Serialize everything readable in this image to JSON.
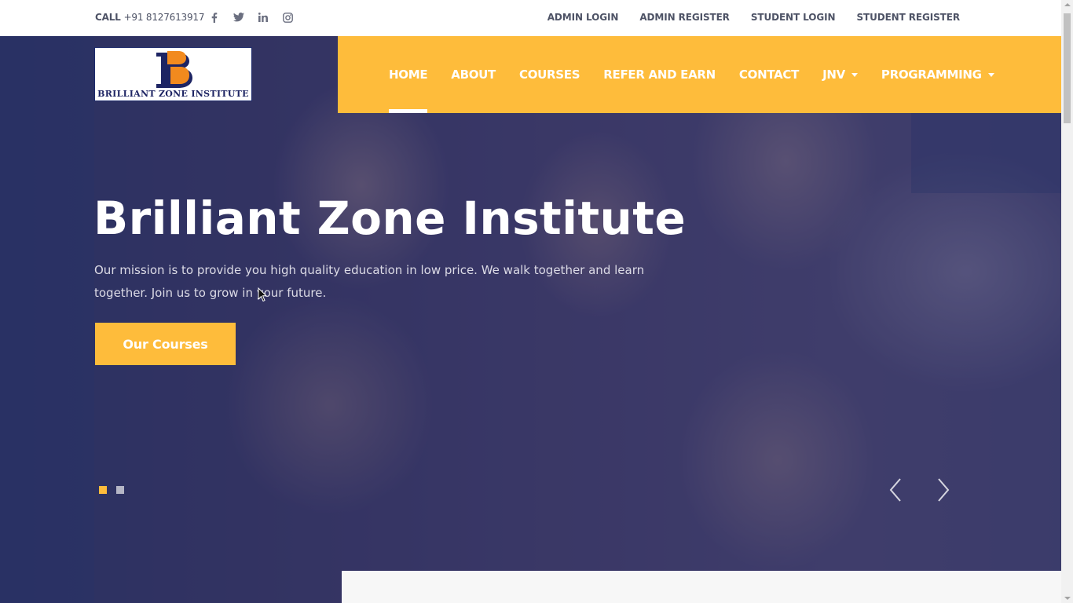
{
  "topbar": {
    "call_label": "CALL",
    "phone": "+91 8127613917",
    "socials": [
      {
        "icon": "facebook-icon"
      },
      {
        "icon": "twitter-icon"
      },
      {
        "icon": "linkedin-icon"
      },
      {
        "icon": "instagram-icon"
      }
    ],
    "links": [
      "ADMIN LOGIN",
      "ADMIN REGISTER",
      "STUDENT LOGIN",
      "STUDENT REGISTER"
    ]
  },
  "logo": {
    "brand_name": "BRILLIANT ZONE INSTITUTE"
  },
  "nav": {
    "items": [
      {
        "label": "HOME",
        "active": true
      },
      {
        "label": "ABOUT"
      },
      {
        "label": "COURSES"
      },
      {
        "label": "REFER AND EARN"
      },
      {
        "label": "CONTACT"
      },
      {
        "label": "JNV",
        "dropdown": true
      },
      {
        "label": "PROGRAMMING",
        "dropdown": true
      }
    ]
  },
  "hero": {
    "title": "Brilliant Zone Institute",
    "text": "Our mission is to provide you high quality education in low price. We walk together and learn together. Join us to grow in your future.",
    "cta_label": "Our Courses",
    "slides_total": 2,
    "active_slide": 1
  },
  "colors": {
    "accent": "#febc3b",
    "text_dark": "#4e5366",
    "hero_overlay": "#2d2a5a",
    "white": "#ffffff"
  }
}
